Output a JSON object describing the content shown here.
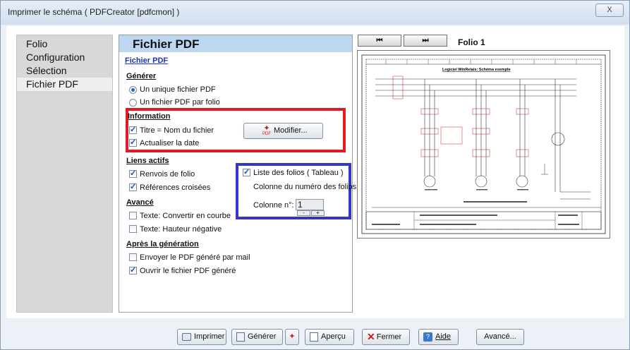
{
  "window": {
    "title": "Imprimer le schéma ( PDFCreator [pdfcmon] )",
    "close_label": "X"
  },
  "nav": {
    "items": [
      "Folio",
      "Configuration",
      "Sélection",
      "Fichier PDF"
    ],
    "selected": 3
  },
  "panel": {
    "header": "Fichier PDF",
    "link": "Fichier PDF",
    "generer": {
      "title": "Générer",
      "options": [
        {
          "label": "Un unique fichier PDF",
          "checked": true
        },
        {
          "label": "Un fichier PDF par folio",
          "checked": false
        }
      ]
    },
    "information": {
      "title": "Information",
      "titre_label": "Titre = Nom du fichier",
      "actualiser_label": "Actualiser la date",
      "modifier_label": "Modifier...",
      "pdf_badge": "PDF"
    },
    "liens": {
      "title": "Liens actifs",
      "renvois_label": "Renvois de folio",
      "references_label": "Références croisées",
      "liste_label": "Liste des folios ( Tableau )",
      "colonne_numero_label": "Colonne du numéro des folios:",
      "colonne_n_label": "Colonne n°:",
      "colonne_value": "1",
      "spin_minus": "-",
      "spin_plus": "+"
    },
    "avance": {
      "title": "Avancé",
      "texte_courbe_label": "Texte: Convertir en courbe",
      "texte_hauteur_label": "Texte: Hauteur négative"
    },
    "apres": {
      "title": "Après la génération",
      "envoyer_label": "Envoyer le PDF généré par mail",
      "ouvrir_label": "Ouvrir le fichier PDF généré"
    }
  },
  "preview": {
    "first_label": "⏮",
    "next_label": "⏭",
    "folio_label": "Folio 1",
    "sheet_title": "Logiciel WinRelais: Schéma exemple"
  },
  "footer": {
    "imprimer": "Imprimer",
    "generer": "Générer",
    "apercu": "Aperçu",
    "fermer": "Fermer",
    "aide": "Aide",
    "avance": "Avancé..."
  },
  "colors": {
    "red_highlight": "#e01b24",
    "blue_highlight": "#3436c8",
    "panel_header": "#bdd7f0",
    "link": "#1b35b5"
  }
}
